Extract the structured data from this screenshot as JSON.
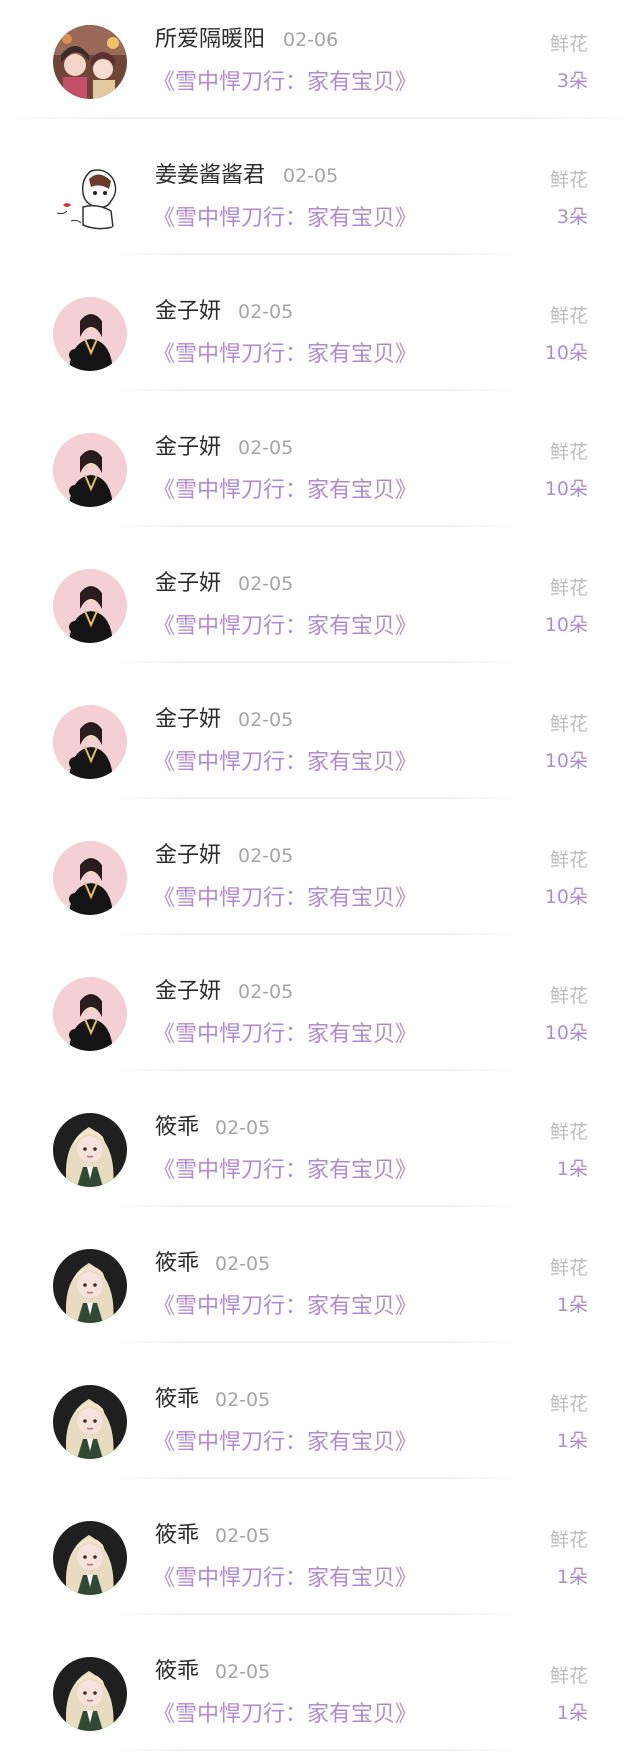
{
  "rows": [
    {
      "user": "所爱隔暖阳",
      "date": "02-06",
      "book": "《雪中悍刀行：家有宝贝》",
      "gift": "鲜花",
      "count": "3朵",
      "avatar": "anime-group-avatar"
    },
    {
      "user": "姜姜酱酱君",
      "date": "02-05",
      "book": "《雪中悍刀行：家有宝贝》",
      "gift": "鲜花",
      "count": "3朵",
      "avatar": "sketch-cat-avatar"
    },
    {
      "user": "金子妍",
      "date": "02-05",
      "book": "《雪中悍刀行：家有宝贝》",
      "gift": "鲜花",
      "count": "10朵",
      "avatar": "girl-pink-bg-avatar"
    },
    {
      "user": "金子妍",
      "date": "02-05",
      "book": "《雪中悍刀行：家有宝贝》",
      "gift": "鲜花",
      "count": "10朵",
      "avatar": "girl-pink-bg-avatar"
    },
    {
      "user": "金子妍",
      "date": "02-05",
      "book": "《雪中悍刀行：家有宝贝》",
      "gift": "鲜花",
      "count": "10朵",
      "avatar": "girl-pink-bg-avatar"
    },
    {
      "user": "金子妍",
      "date": "02-05",
      "book": "《雪中悍刀行：家有宝贝》",
      "gift": "鲜花",
      "count": "10朵",
      "avatar": "girl-pink-bg-avatar"
    },
    {
      "user": "金子妍",
      "date": "02-05",
      "book": "《雪中悍刀行：家有宝贝》",
      "gift": "鲜花",
      "count": "10朵",
      "avatar": "girl-pink-bg-avatar"
    },
    {
      "user": "金子妍",
      "date": "02-05",
      "book": "《雪中悍刀行：家有宝贝》",
      "gift": "鲜花",
      "count": "10朵",
      "avatar": "girl-pink-bg-avatar"
    },
    {
      "user": "筱乖",
      "date": "02-05",
      "book": "《雪中悍刀行：家有宝贝》",
      "gift": "鲜花",
      "count": "1朵",
      "avatar": "blonde-girl-avatar"
    },
    {
      "user": "筱乖",
      "date": "02-05",
      "book": "《雪中悍刀行：家有宝贝》",
      "gift": "鲜花",
      "count": "1朵",
      "avatar": "blonde-girl-avatar"
    },
    {
      "user": "筱乖",
      "date": "02-05",
      "book": "《雪中悍刀行：家有宝贝》",
      "gift": "鲜花",
      "count": "1朵",
      "avatar": "blonde-girl-avatar"
    },
    {
      "user": "筱乖",
      "date": "02-05",
      "book": "《雪中悍刀行：家有宝贝》",
      "gift": "鲜花",
      "count": "1朵",
      "avatar": "blonde-girl-avatar"
    },
    {
      "user": "筱乖",
      "date": "02-05",
      "book": "《雪中悍刀行：家有宝贝》",
      "gift": "鲜花",
      "count": "1朵",
      "avatar": "blonde-girl-avatar"
    }
  ],
  "colors": {
    "accent": "#b28ad1",
    "username": "#2c2c2c",
    "muted": "#a4a4a4",
    "gift_label": "#bdbdbd",
    "divider": "#eeeeee"
  }
}
